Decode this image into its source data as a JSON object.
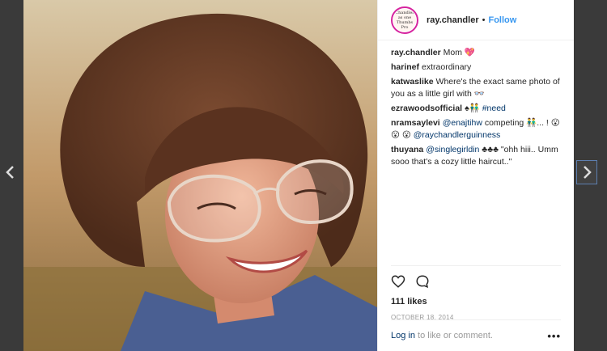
{
  "nav": {
    "prev_icon": "chevron-left-icon",
    "next_icon": "chevron-right-icon"
  },
  "post": {
    "avatar_text": "Chandler as one Thumbs Pro",
    "username": "ray.chandler",
    "separator": "•",
    "follow_label": "Follow"
  },
  "comments": [
    {
      "user": "ray.chandler",
      "text": "Mom 💖"
    },
    {
      "user": "harinef",
      "text": "extraordinary"
    },
    {
      "user": "katwaslike",
      "text": "Where's the exact same photo of you as a little girl with 👓"
    },
    {
      "user": "ezrawoodsofficial",
      "text": "♠👬",
      "tag": "#need"
    },
    {
      "user": "nramsaylevi",
      "mention": "@enajtihw",
      "text": "competing 👬... ! 😮😮",
      "mention2": "@raychandlerguinness",
      "prefix2": "😮 "
    },
    {
      "user": "thuyana",
      "mention": "@singlegirldin",
      "text": "♣♣♣ \"ohh hiii.. Umm sooo that's a cozy little haircut..\""
    }
  ],
  "actions": {
    "like_icon": "heart-icon",
    "comment_icon": "comment-icon"
  },
  "likes": "111 likes",
  "date": "OCTOBER 18, 2014",
  "footer": {
    "login": "Log in",
    "rest": " to like or comment.",
    "more": "•••"
  },
  "colors": {
    "link": "#003569",
    "follow": "#3897f0",
    "backdrop": "#3a3a3a"
  }
}
